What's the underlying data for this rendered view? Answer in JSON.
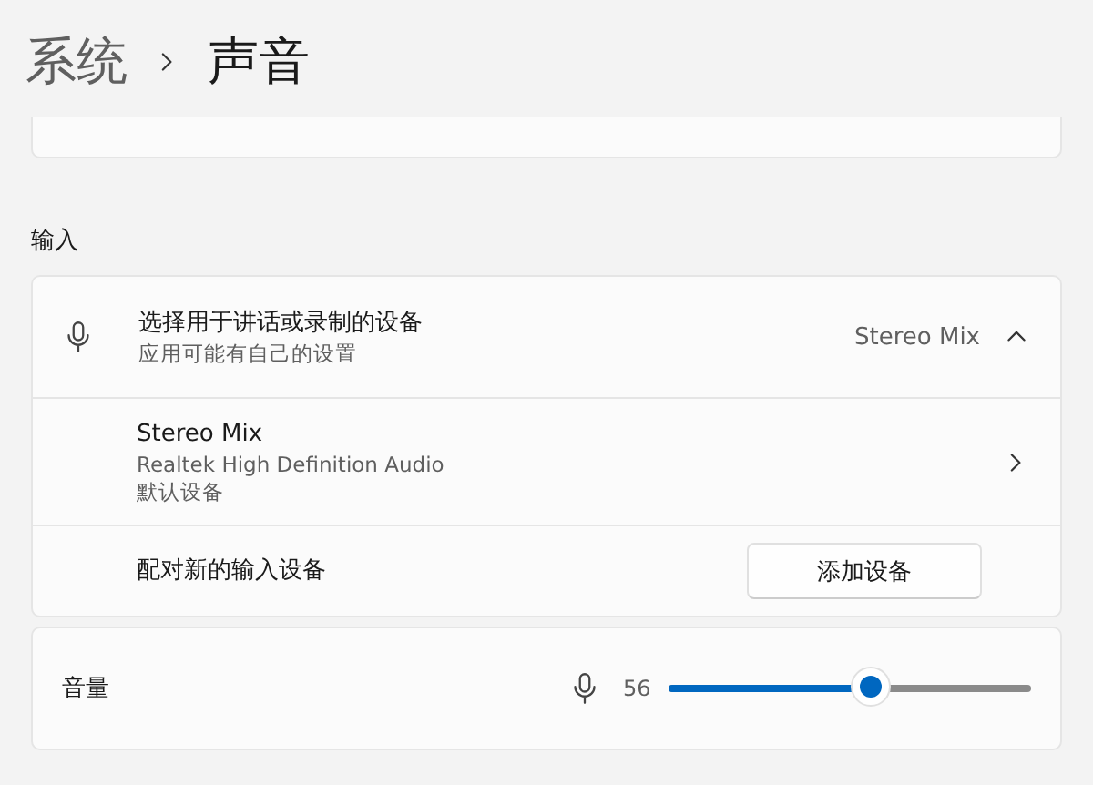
{
  "breadcrumb": [
    {
      "label": "系统",
      "selected": false
    },
    {
      "label": "声音",
      "selected": true
    }
  ],
  "input_section": {
    "title": "输入",
    "device_selector": {
      "title": "选择用于讲话或录制的设备",
      "subtitle": "应用可能有自己的设置",
      "value": "Stereo Mix",
      "expanded": true
    },
    "devices": [
      {
        "name": "Stereo Mix",
        "driver": "Realtek High Definition Audio",
        "status": "默认设备"
      }
    ],
    "pair": {
      "label": "配对新的输入设备",
      "button": "添加设备"
    }
  },
  "volume": {
    "label": "音量",
    "reading": "56",
    "level": 0.56
  }
}
